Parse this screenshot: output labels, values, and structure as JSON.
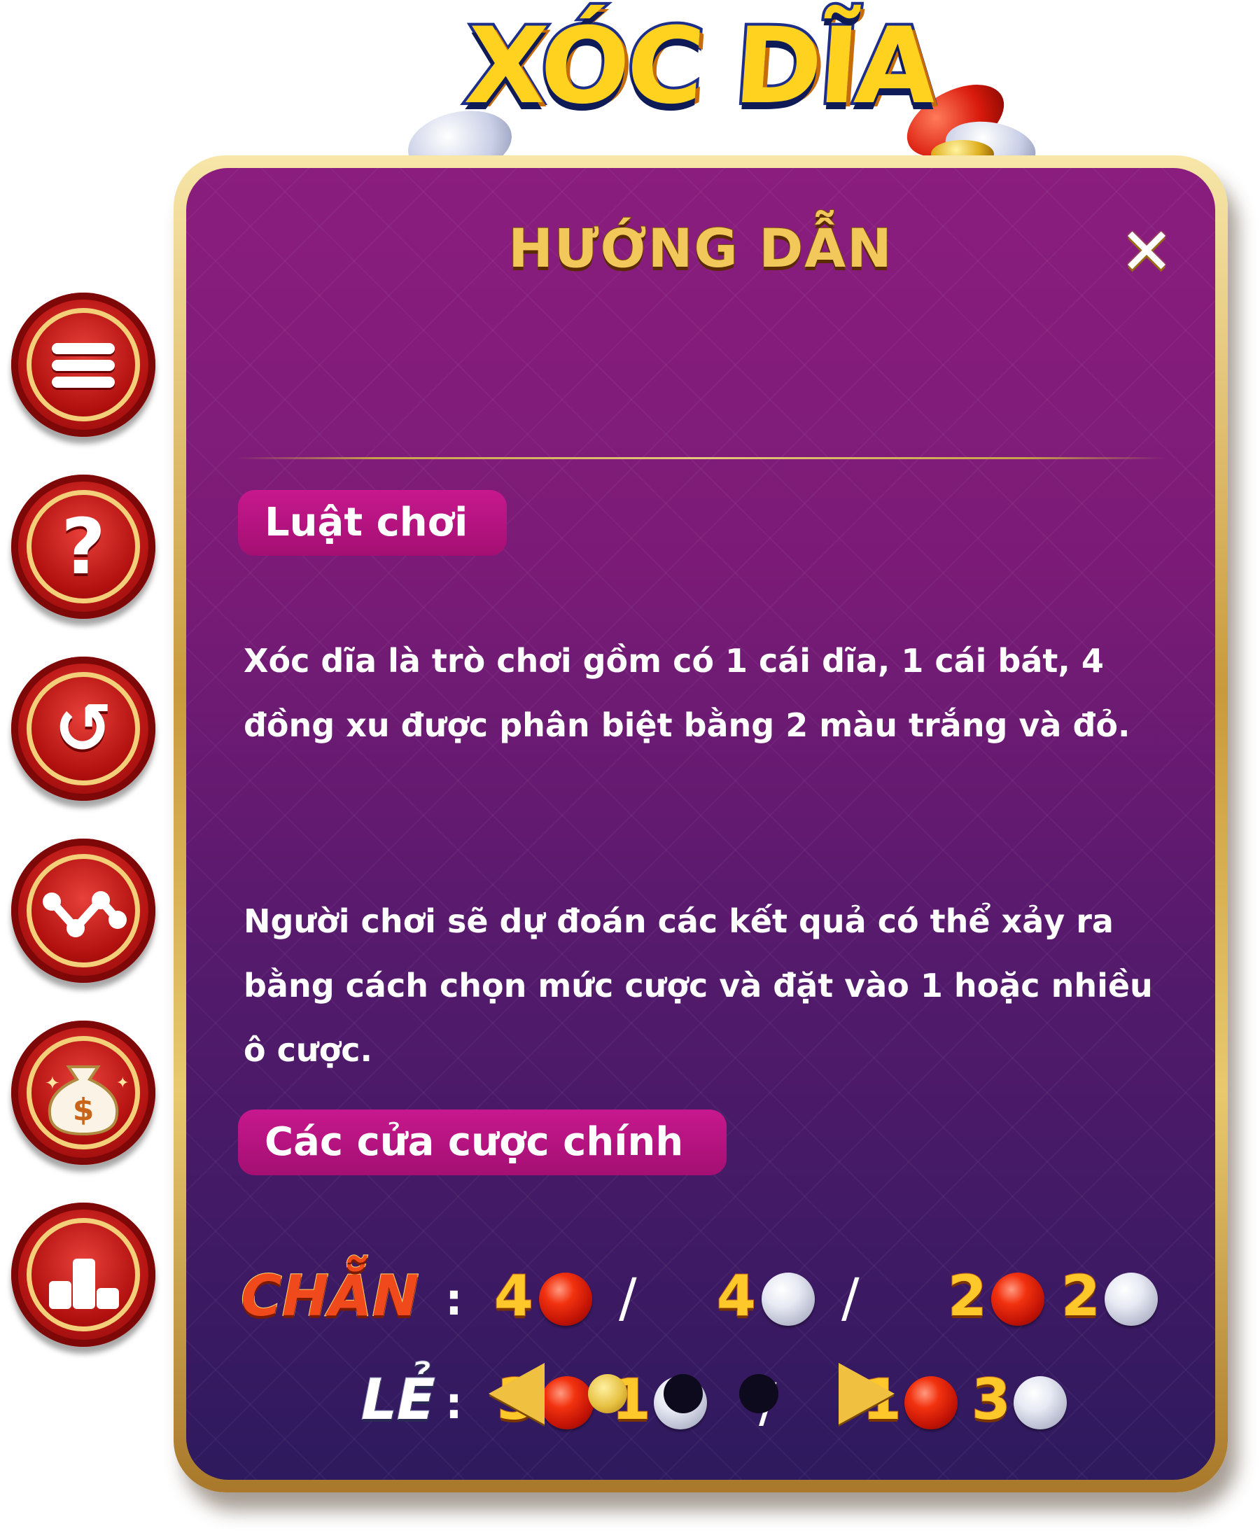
{
  "logo": {
    "text": "XÓC DĨA"
  },
  "panel": {
    "title": "HƯỚNG DẪN",
    "close_icon": "close-icon",
    "sections": [
      {
        "heading": "Luật chơi",
        "paragraphs": [
          "Xóc dĩa là trò chơi gồm có 1 cái dĩa, 1 cái bát, 4 đồng xu được phân biệt bằng 2 màu trắng và đỏ.",
          "Người chơi  sẽ  dự đoán các kết quả có thể xảy ra bằng cách chọn mức cược và đặt vào 1 hoặc nhiều ô cược."
        ]
      },
      {
        "heading": "Các cửa cược chính"
      }
    ],
    "bets": {
      "chan": {
        "label": "CHẴN",
        "colon": ":",
        "combos": [
          {
            "red": "4"
          },
          {
            "white": "4"
          },
          {
            "red": "2",
            "white": "2"
          }
        ]
      },
      "le": {
        "label": "LẺ",
        "colon": ":",
        "combos": [
          {
            "red": "3",
            "white": "1"
          },
          {
            "red": "1",
            "white": "3"
          }
        ]
      },
      "separator": "/"
    },
    "pager": {
      "pages": 3,
      "current_page": 1,
      "prev_icon": "arrow-left-icon",
      "next_icon": "arrow-right-icon"
    }
  },
  "side_menu": [
    {
      "icon": "menu-icon"
    },
    {
      "icon": "help-icon",
      "glyph": "?"
    },
    {
      "icon": "history-icon",
      "glyph": "↺"
    },
    {
      "icon": "stats-chart-icon",
      "glyph": "⟋"
    },
    {
      "icon": "money-bag-icon",
      "glyph": "$"
    },
    {
      "icon": "leaderboard-icon",
      "glyph": "▁▃▁"
    }
  ],
  "colors": {
    "panel_top": "#8a1d7e",
    "panel_bottom": "#2e1a5e",
    "gold": "#f2c85a",
    "pill": "#c7188d",
    "side_button": "#b81614"
  }
}
